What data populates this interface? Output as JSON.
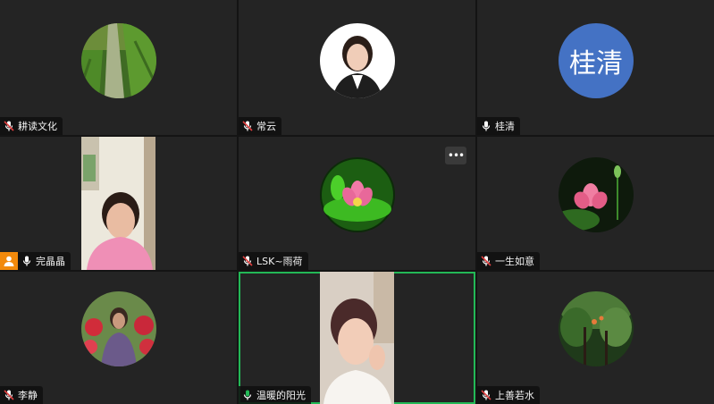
{
  "participants": [
    {
      "name": "耕读文化",
      "mic": "muted",
      "avatar_type": "photo",
      "avatar_desc": "road-through-fields-photo"
    },
    {
      "name": "常云",
      "mic": "muted",
      "avatar_type": "photo",
      "avatar_desc": "portrait-photo"
    },
    {
      "name": "桂清",
      "mic": "unmuted",
      "avatar_type": "initials",
      "avatar_text": "桂清",
      "avatar_color": "#4472c4"
    },
    {
      "name": "完晶晶",
      "mic": "unmuted",
      "avatar_type": "video",
      "host": true
    },
    {
      "name": "LSK~雨荷",
      "mic": "muted",
      "avatar_type": "photo",
      "avatar_desc": "lotus-on-green-photo"
    },
    {
      "name": "一生如意",
      "mic": "muted",
      "avatar_type": "photo",
      "avatar_desc": "pink-lotus-photo"
    },
    {
      "name": "李静",
      "mic": "muted",
      "avatar_type": "photo",
      "avatar_desc": "woman-with-flowers-photo"
    },
    {
      "name": "温暖的阳光",
      "mic": "speaking",
      "avatar_type": "video",
      "active_speaker": true
    },
    {
      "name": "上善若水",
      "mic": "muted",
      "avatar_type": "photo",
      "avatar_desc": "forest-trees-photo"
    }
  ],
  "colors": {
    "tile_bg": "#242424",
    "active_border": "#23b856",
    "host_badge": "#f28a0c",
    "muted_icon": "#e04040",
    "speaking_icon": "#23b856"
  },
  "icons": {
    "more": "more-options-icon",
    "host": "host-person-icon"
  }
}
